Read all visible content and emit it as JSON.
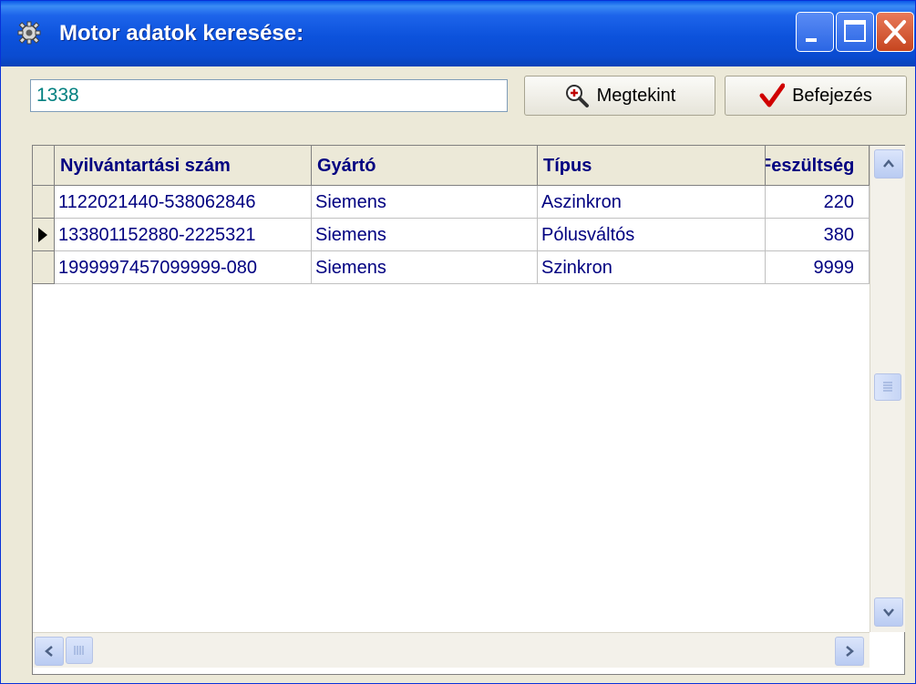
{
  "window": {
    "title": "Motor adatok keresése:",
    "icon": "gear-icon"
  },
  "search": {
    "value": "1338"
  },
  "toolbar": {
    "view_label": "Megtekint",
    "view_icon": "magnifier-plus-icon",
    "finish_label": "Befejezés",
    "finish_icon": "checkmark-icon"
  },
  "grid": {
    "columns": [
      "Nyilvántartási szám",
      "Gyártó",
      "Típus",
      "Feszültség"
    ],
    "rows": [
      {
        "id": "1122021440-538062846",
        "manufacturer": "Siemens",
        "type": "Aszinkron",
        "voltage": "220"
      },
      {
        "id": "133801152880-2225321",
        "manufacturer": "Siemens",
        "type": "Pólusváltós",
        "voltage": "380"
      },
      {
        "id": "1999997457099999-080",
        "manufacturer": "Siemens",
        "type": "Szinkron",
        "voltage": "9999"
      }
    ],
    "current_row_index": 1
  },
  "colors": {
    "titlebar": "#0a4bd0",
    "grid_text": "#000080",
    "search_text": "#008080",
    "close_button": "#c6451f"
  }
}
